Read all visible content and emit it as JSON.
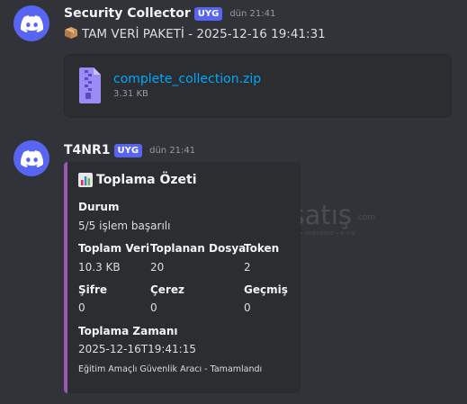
{
  "colors": {
    "background": "#313338",
    "accent": "#5865f2",
    "link": "#00a8fc",
    "embed_border": "#9b59b6"
  },
  "messages": [
    {
      "author": "Security Collector",
      "badge": "UYG",
      "timestamp": "dün 21:41",
      "avatar_icon": "discord-logo-icon",
      "content_icon": "package-emoji-icon",
      "content": "TAM VERİ PAKETİ - 2025-12-16 19:41:31",
      "attachment": {
        "icon": "zip-file-icon",
        "filename": "complete_collection.zip",
        "size": "3.31 KB"
      }
    },
    {
      "author": "T4NR1",
      "badge": "UYG",
      "timestamp": "dün 21:41",
      "avatar_icon": "discord-logo-icon",
      "embed": {
        "title_icon": "bar-chart-emoji-icon",
        "title": "Toplama Özeti",
        "fields": {
          "durum": {
            "name": "Durum",
            "value": "5/5 işlem başarılı"
          },
          "toplam_veri": {
            "name": "Toplam Veri",
            "value": "10.3 KB"
          },
          "toplanan_dosya": {
            "name": "Toplanan Dosya",
            "value": "20"
          },
          "token": {
            "name": "Token",
            "value": "2"
          },
          "sifre": {
            "name": "Şifre",
            "value": "0"
          },
          "cerez": {
            "name": "Çerez",
            "value": "0"
          },
          "gecmis": {
            "name": "Geçmiş",
            "value": "0"
          },
          "zaman": {
            "name": "Toplama Zamanı",
            "value": "2025-12-16T19:41:15"
          }
        },
        "footer": "Eğitim Amaçlı Güvenlik Aracı - Tamamlandı"
      }
    }
  ],
  "watermark": {
    "text": "itemsatış",
    "tagline": "GÜVENLİ • SORUNSUZ • E-PİN",
    "suffix": ".com"
  }
}
